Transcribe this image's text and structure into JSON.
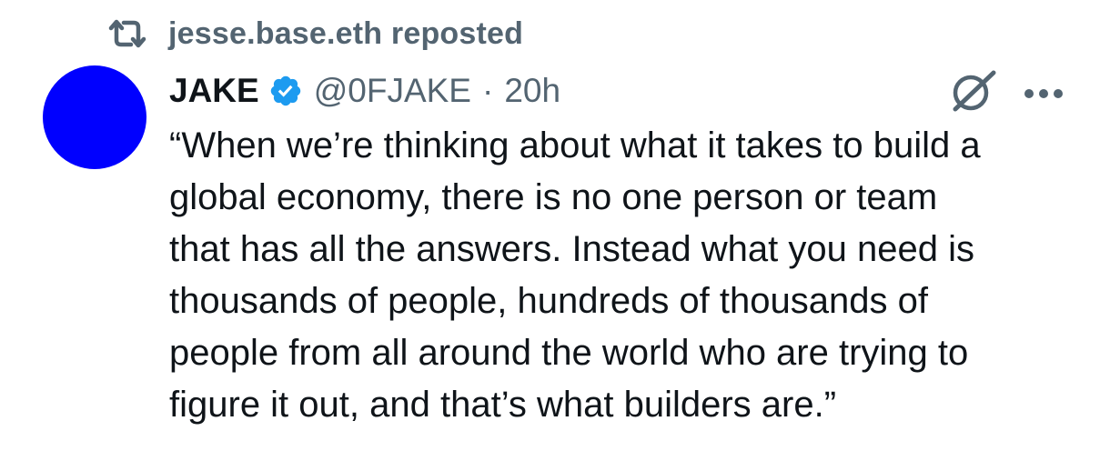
{
  "repost": {
    "icon": "repost-icon",
    "text": "jesse.base.eth reposted"
  },
  "tweet": {
    "avatar_color": "#0000ff",
    "display_name": "JAKE",
    "verified_icon": "verified-badge-icon",
    "verified_color": "#1d9bf0",
    "handle": "@0FJAKE",
    "separator": "·",
    "time": "20h",
    "grok_icon": "grok-icon",
    "more_icon": "more-options-icon",
    "text": "“When we’re thinking about what it takes to build a\nglobal economy, there is no one person or team\nthat has all the answers. Instead what you need is\nthousands of people, hundreds of thousands of\npeople from all around the world who are trying to\nfigure it out, and that’s what builders are.”"
  }
}
